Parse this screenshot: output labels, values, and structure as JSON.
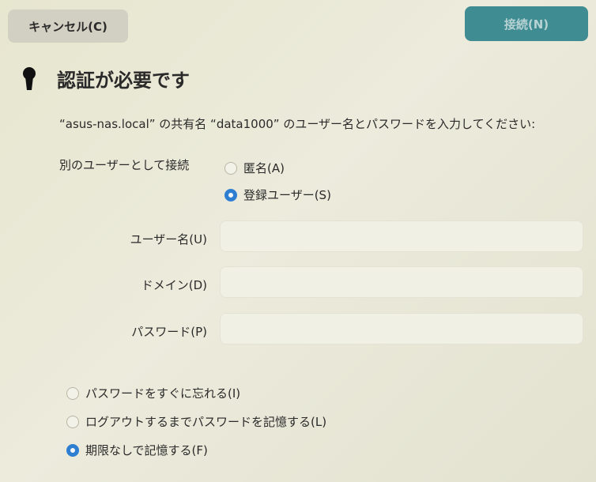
{
  "header": {
    "cancel_label": "キャンセル(C)",
    "connect_label": "接続(N)"
  },
  "dialog": {
    "title": "認証が必要です",
    "message": "“asus-nas.local” の共有名 “data1000” のユーザー名とパスワードを入力してください:",
    "connect_as_label": "別のユーザーとして接続",
    "connect_as_options": [
      {
        "label": "匿名(A)",
        "selected": false
      },
      {
        "label": "登録ユーザー(S)",
        "selected": true
      }
    ],
    "fields": {
      "username": {
        "label": "ユーザー名(U)",
        "value": ""
      },
      "domain": {
        "label": "ドメイン(D)",
        "value": ""
      },
      "password": {
        "label": "パスワード(P)",
        "value": ""
      }
    },
    "remember_options": [
      {
        "label": "パスワードをすぐに忘れる(I)",
        "selected": false
      },
      {
        "label": "ログアウトするまでパスワードを記憶する(L)",
        "selected": false
      },
      {
        "label": "期限なしで記憶する(F)",
        "selected": true
      }
    ]
  },
  "colors": {
    "accent": "#2e7fd1",
    "connect_button": "#3f8c93",
    "background": "#e9e8d6"
  },
  "icons": {
    "title_icon": "keyhole-icon"
  }
}
